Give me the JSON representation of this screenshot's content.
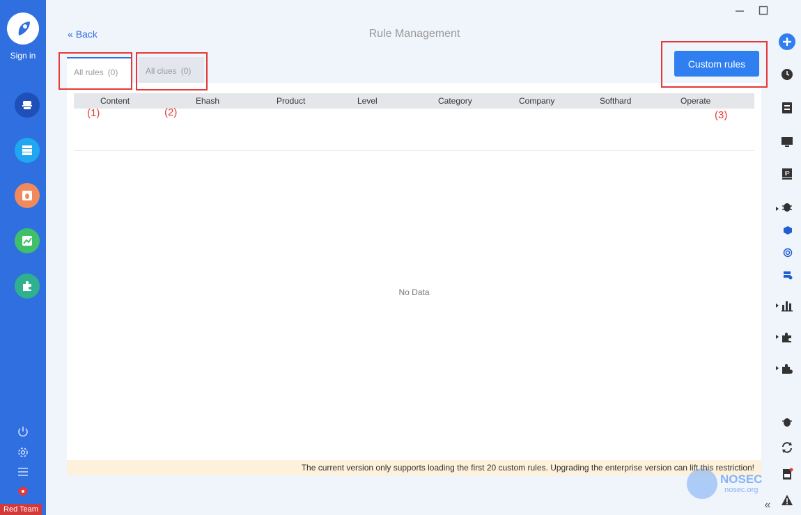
{
  "sidebar": {
    "signin_label": "Sign in",
    "badge_label": "Red Team",
    "nav": [
      {
        "icon": "detective-icon",
        "color": "#1f4fb8"
      },
      {
        "icon": "server-list-icon",
        "color": "#1fa7f0"
      },
      {
        "icon": "bug-icon",
        "color": "#f08a5d"
      },
      {
        "icon": "chart-icon",
        "color": "#3fbf6a"
      },
      {
        "icon": "puzzle-icon",
        "color": "#2fb08f"
      }
    ]
  },
  "header": {
    "back_label": "Back",
    "title": "Rule Management"
  },
  "tabs": [
    {
      "label": "All rules",
      "count": "(0)"
    },
    {
      "label": "All clues",
      "count": "(0)"
    }
  ],
  "actions": {
    "custom_rules_label": "Custom rules"
  },
  "table": {
    "columns": [
      "Content",
      "Ehash",
      "Product",
      "Level",
      "Category",
      "Company",
      "Softhard",
      "Operate"
    ],
    "empty_text": "No Data"
  },
  "notice": "The current version only supports loading the first 20 custom rules. Upgrading the enterprise version can lift this restriction!",
  "annotations": [
    "(1)",
    "(2)",
    "(3)"
  ],
  "watermark": {
    "brand": "NOSEC",
    "domain": "nosec.org"
  },
  "colors": {
    "accent": "#2f7ff0",
    "sidebar": "#2f6fe0",
    "annotation": "#e53935"
  }
}
